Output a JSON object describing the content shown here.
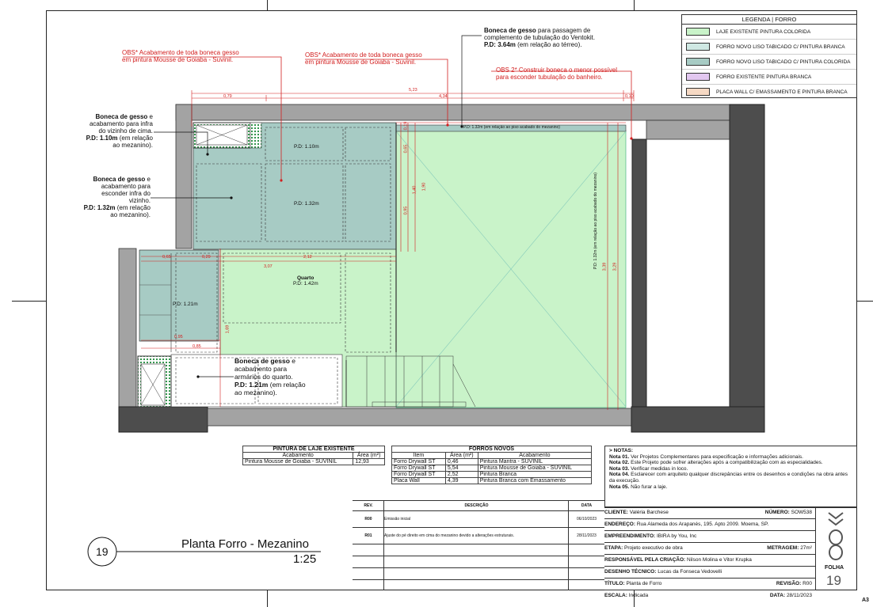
{
  "legend": {
    "title": "LEGENDA | FORRO",
    "items": [
      {
        "label": "LAJE EXISTENTE PINTURA COLORIDA",
        "color": "#c9f3c9"
      },
      {
        "label": "FORRO NOVO LISO TABICADO C/ PINTURA BRANCA",
        "color": "#cfe8e3"
      },
      {
        "label": "FORRO NOVO LISO TABICADO C/ PINTURA COLORIDA",
        "color": "#a7cbc4"
      },
      {
        "label": "FORRO EXISTENTE PINTURA BRANCA",
        "color": "#e2c7f0"
      },
      {
        "label": "PLACA WALL C/ EMASSAMENTO E PINTURA BRANCA",
        "color": "#f6d9c4"
      }
    ]
  },
  "annotations": {
    "obs1": [
      "OBS* Acabamento de toda boneca gesso",
      "em pintura Mousse de Goiaba - Suvinil."
    ],
    "obs2": [
      "OBS* Acabamento de toda boneca gesso",
      "em pintura Mousse de Goiaba - Suvinil."
    ],
    "obs3": [
      "OBS 2* Construir boneca o menor possível",
      "para esconder tubulação do banheiro."
    ],
    "ventokit": {
      "bold": "Boneca de gesso",
      "l1": " para passagem de",
      "l2": "complemento de tubulação do Ventokit.",
      "pd": "P.D: 3.64m",
      "pd_rest": " (em relação ao térreo)."
    },
    "left1": {
      "bold": "Boneca de gesso",
      "rest": " e",
      "l2": "acabamento para infra",
      "l3": "do vizinho de cima.",
      "pd": "P.D: 1.10m",
      "pd_rest": " (em relação",
      "l5": "ao mezanino)."
    },
    "left2": {
      "bold": "Boneca de gesso",
      "rest": " e",
      "l2": "acabamento para",
      "l3": "esconder infra do",
      "l4": "vizinho.",
      "pd": "P.D: 1.32m",
      "pd_rest": " (em relação",
      "l6": "ao mezanino)."
    },
    "center": {
      "bold": "Boneca de gesso",
      "rest": " e",
      "l2": "acabamento para",
      "l3": "armários do quarto.",
      "pd": "P.D: 1.21m",
      "pd_rest": " (em relação",
      "l5": "ao mezanino)."
    }
  },
  "plan_labels": {
    "pd110": "P.D: 1.10m",
    "pd132": "P.D: 1.32m",
    "pd121": "P.D: 1.21m",
    "quarto": "Quarto",
    "pd142": "P.D: 1.42m",
    "pd_top": "P.D: 1.32m (em relação ao piso acabado do mezanino)",
    "pd_right": "P.D: 1.32m (em relação ao piso acabado do mezanino)",
    "dims": {
      "d523": "5,23",
      "d079": "0,79",
      "d434": "4,34",
      "d010": "0,10",
      "d065": "0,65",
      "d029": "0,29",
      "d212": "2,12",
      "d307": "3,07",
      "d095": "0,95",
      "d085": "0,85",
      "d169": "1,69",
      "v065": "0,65",
      "v140": "1,40",
      "v190": "1,90",
      "v095": "0,95",
      "v339": "3,39",
      "v329": "3,29",
      "v019": "0,19"
    }
  },
  "table_pintura": {
    "title": "PINTURA DE LAJE EXISTENTE",
    "headers": [
      "Acabamento",
      "Área (m²)"
    ],
    "rows": [
      [
        "Pintura Mousse de Goiaba - SUVINIL",
        "12,93"
      ]
    ]
  },
  "table_forros": {
    "title": "FORROS NOVOS",
    "headers": [
      "Item",
      "Área (m²)",
      "Acabamento"
    ],
    "rows": [
      [
        "Forro Drywall ST",
        "0,46",
        "Pintura Mantra - SUVINIL"
      ],
      [
        "Forro Drywall ST",
        "5,54",
        "Pintura Mousse de Goiaba - SUVINIL"
      ],
      [
        "Forro Drywall ST",
        "2,52",
        "Pintura Branca"
      ],
      [
        "Placa Wall",
        "4,39",
        "Pintura Branca com Emassamento"
      ]
    ]
  },
  "notes": {
    "title": "> NOTAS:",
    "items": [
      {
        "b": "Nota 01.",
        "t": " Ver Projetos Complementares para especificação e informações adicionais."
      },
      {
        "b": "Nota 02.",
        "t": " Este Projeto pode sofrer alterações após a compatibilização com as especialidades."
      },
      {
        "b": "Nota 03.",
        "t": " Verificar medidas in loco."
      },
      {
        "b": "Nota 04.",
        "t": " Esclarecer com arquiteto qualquer discrepâncias entre os desenhos e condições na obra antes da execução."
      },
      {
        "b": "Nota 05.",
        "t": " Não furar a laje."
      }
    ]
  },
  "revisions": {
    "headers": [
      "REV.",
      "DESCRIÇÃO",
      "DATA"
    ],
    "rows": [
      [
        "R00",
        "Emissão inicial",
        "06/10/2023"
      ],
      [
        "R01",
        "Ajuste do pé direito em cima do mezanino devido a alterações estruturais.",
        "28/11/2023"
      ]
    ]
  },
  "info": {
    "cliente_k": "CLIENTE:",
    "cliente_v": "Valéria Barchese",
    "numero_k": "NÚMERO:",
    "numero_v": "SOW538",
    "endereco_k": "ENDEREÇO:",
    "endereco_v": "Rua Alameda dos Arapanés, 195. Apto 2009. Moema, SP.",
    "emp_k": "EMPREENDIMENTO:",
    "emp_v": "IBIRA by You, Inc",
    "etapa_k": "ETAPA:",
    "etapa_v": "Projeto executivo de obra",
    "metragem_k": "METRAGEM:",
    "metragem_v": "27m²",
    "resp_k": "RESPONSÁVEL PELA CRIAÇÃO:",
    "resp_v": "Nilson Molina e Vitor Krupka",
    "desenho_k": "DESENHO TÉCNICO:",
    "desenho_v": "Lucas da Fonseca Vedovelli",
    "titulo_k": "TÍTULO:",
    "titulo_v": "Planta de Forro",
    "revisao_k": "REVISÃO:",
    "revisao_v": "R00",
    "escala_k": "ESCALA:",
    "escala_v": "Indicada",
    "data_k": "DATA:",
    "data_v": "28/11/2023"
  },
  "folha_label": "FOLHA",
  "folha_num": "19",
  "drawing_number": "19",
  "drawing_title": "Planta Forro - Mezanino",
  "drawing_scale": "1:25",
  "paper_size": "A3",
  "colors": {
    "red": "#d21e1e",
    "wall": "#9a9a9a",
    "dark": "#4d4d4d",
    "teal": "#a7cbc4",
    "green": "#c9f3c9"
  }
}
